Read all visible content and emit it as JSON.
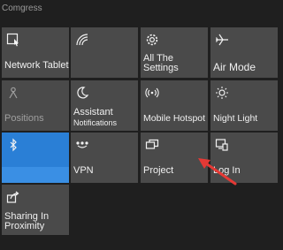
{
  "panel": {
    "header": "Comgress"
  },
  "tiles": [
    {
      "label": "Network Tablet Mode",
      "icon": "tablet-mode-icon"
    },
    {
      "label": "",
      "icon": "network-icon"
    },
    {
      "label": "All The Settings",
      "icon": "gear-icon"
    },
    {
      "label": "Air Mode",
      "icon": "airplane-icon"
    },
    {
      "label": "Positions",
      "icon": "location-icon"
    },
    {
      "label": "Assistant",
      "sublabel": "Notifications",
      "icon": "moon-icon"
    },
    {
      "label": "Mobile Hotspot",
      "icon": "hotspot-icon"
    },
    {
      "label": "Night Light",
      "icon": "brightness-icon"
    },
    {
      "label": "",
      "icon": "bluetooth-icon"
    },
    {
      "label": "VPN",
      "icon": "vpn-icon"
    },
    {
      "label": "Project",
      "icon": "project-icon"
    },
    {
      "label": "Log In",
      "icon": "connect-icon"
    },
    {
      "label": "Sharing In Proximity",
      "icon": "share-icon"
    }
  ],
  "accent": "#2a7fd6",
  "annotation": {
    "arrow_color": "#e53935"
  }
}
